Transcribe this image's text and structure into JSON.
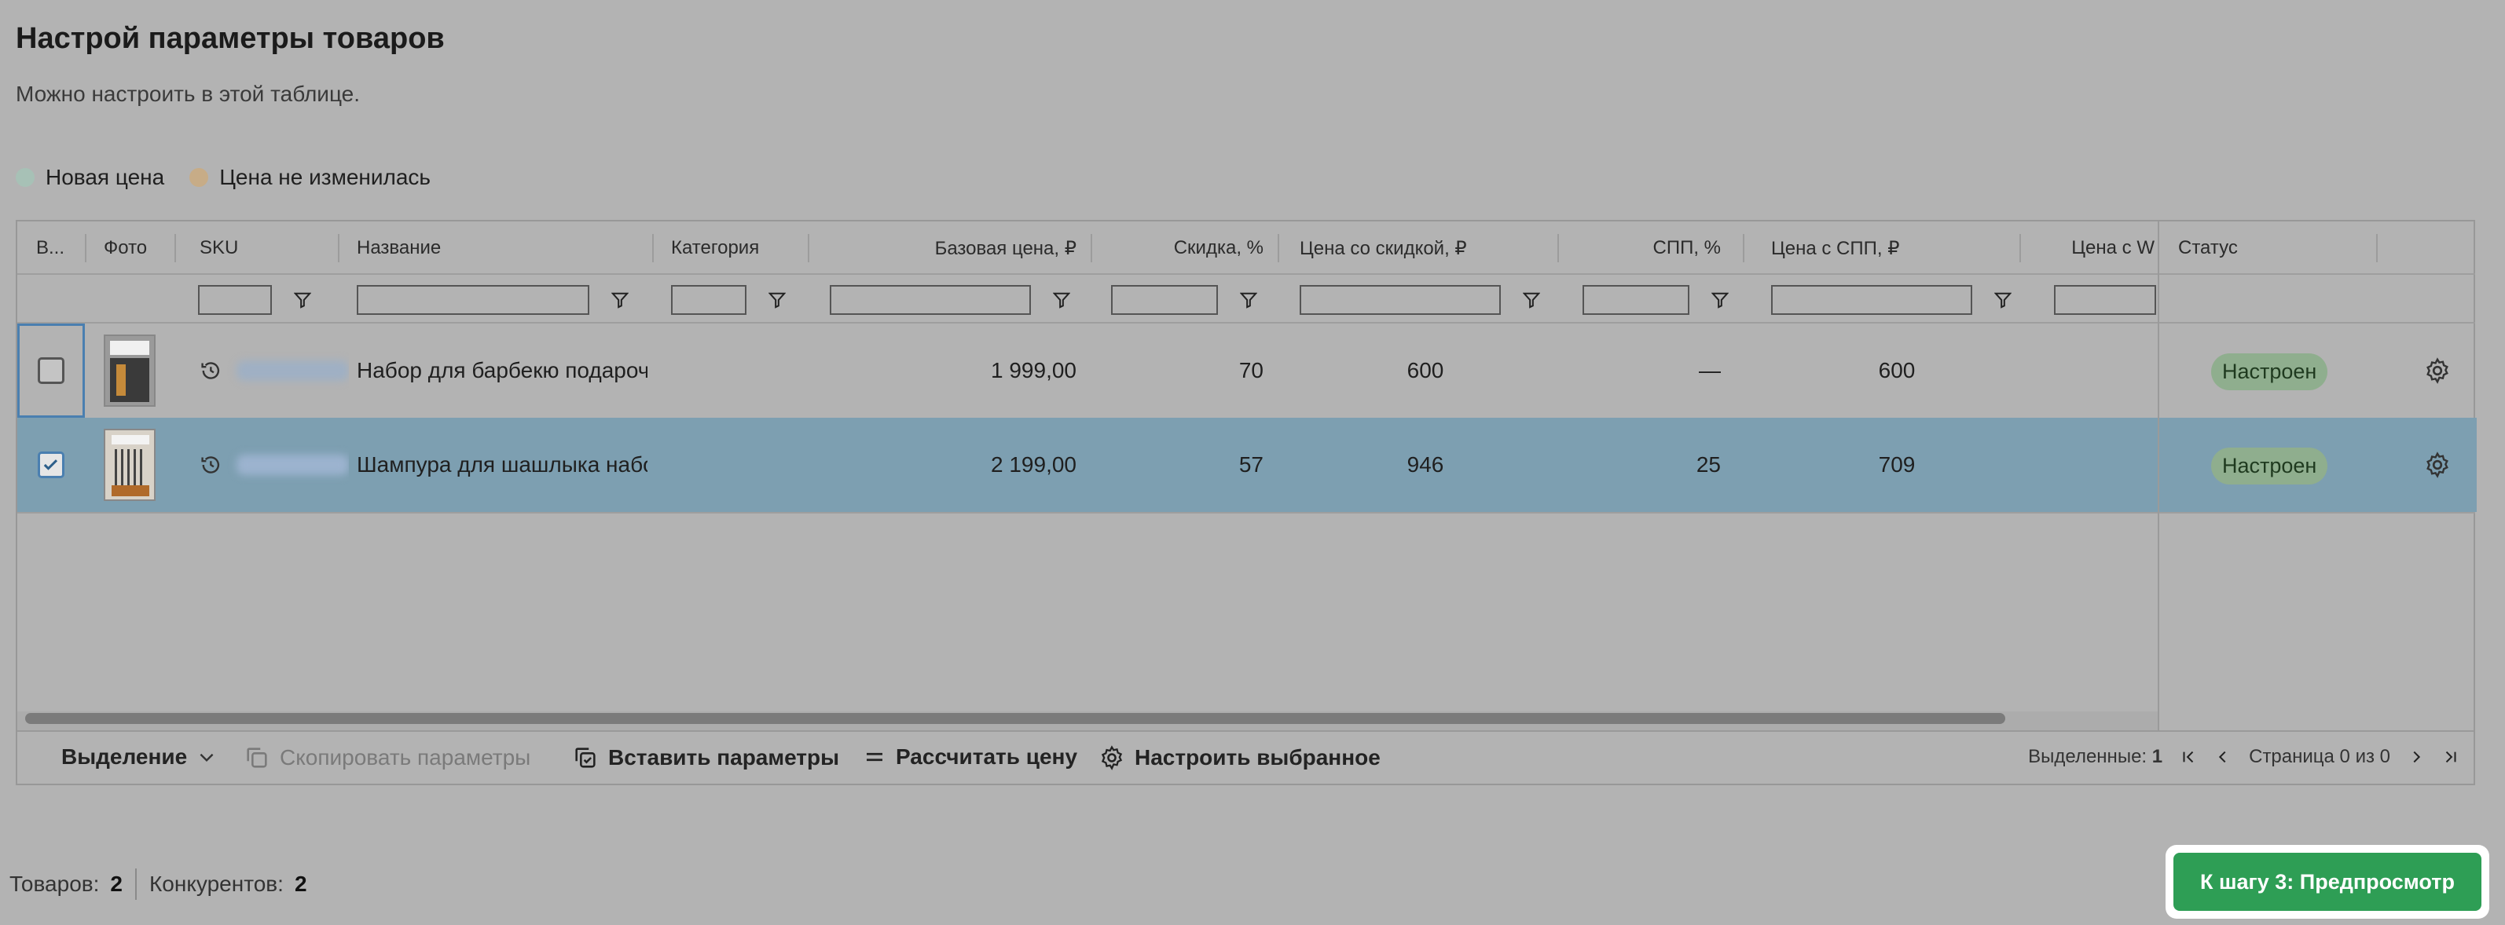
{
  "header": {
    "title": "Настрой параметры товаров",
    "subtitle": "Можно настроить в этой таблице."
  },
  "legend": [
    {
      "label": "Новая цена",
      "color": "#a7c1b6"
    },
    {
      "label": "Цена не изменилась",
      "color": "#c7ac87"
    }
  ],
  "table": {
    "columns": {
      "select": "В...",
      "photo": "Фото",
      "sku": "SKU",
      "name": "Название",
      "category": "Категория",
      "base_price": "Базовая цена, ₽",
      "discount": "Скидка, %",
      "discounted_price": "Цена со скидкой, ₽",
      "spp": "СПП, %",
      "spp_price": "Цена с СПП, ₽",
      "wallet_price": "Цена с W",
      "status": "Статус"
    },
    "rows": [
      {
        "checked": false,
        "name": "Набор для барбекю подароч",
        "base_price": "1 999,00",
        "discount": "70",
        "discounted_price": "600",
        "spp": "—",
        "spp_price": "600",
        "status": "Настроен"
      },
      {
        "checked": true,
        "name": "Шампура для шашлыка набо",
        "base_price": "2 199,00",
        "discount": "57",
        "discounted_price": "946",
        "spp": "25",
        "spp_price": "709",
        "status": "Настроен"
      }
    ]
  },
  "toolbar": {
    "selection": "Выделение",
    "copy_params": "Скопировать параметры",
    "paste_params": "Вставить параметры",
    "calc_price": "Рассчитать цену",
    "configure_selected": "Настроить выбранное"
  },
  "pager": {
    "selected_label": "Выделенные:",
    "selected_count": "1",
    "page_text": "Страница 0 из 0"
  },
  "footer": {
    "products_label": "Товаров:",
    "products_count": "2",
    "competitors_label": "Конкурентов:",
    "competitors_count": "2",
    "next_button": "К шагу 3: Предпросмотр"
  }
}
